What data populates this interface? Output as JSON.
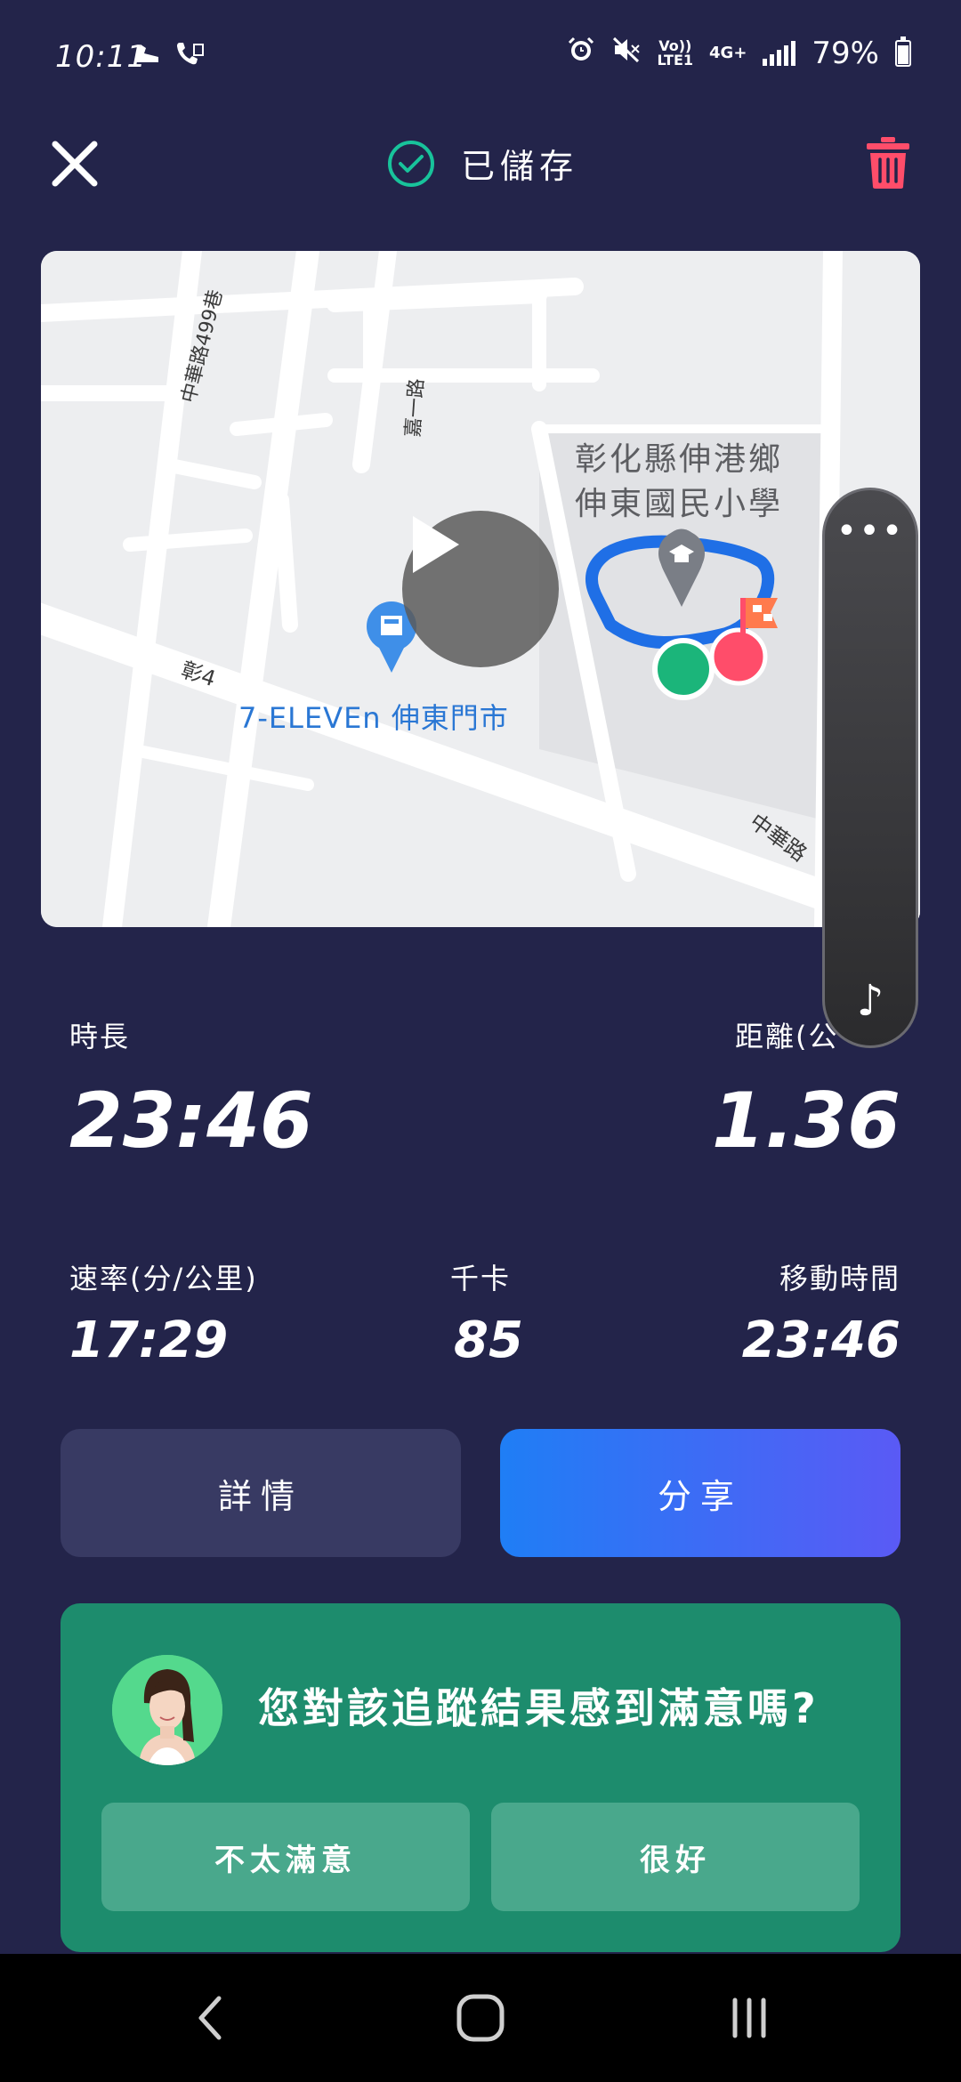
{
  "status_bar": {
    "time": "10:11",
    "network_top": "Vo))",
    "network_bottom": "LTE1",
    "network_type": "4G+",
    "battery": "79%",
    "battery_level": 0.79,
    "icons": [
      "shoe-icon",
      "call-icon",
      "alarm-icon",
      "mute-icon",
      "signal-icon",
      "battery-icon"
    ]
  },
  "top_bar": {
    "saved_label": "已儲存",
    "close_icon": "close-icon",
    "trash_icon": "trash-icon",
    "accent": "#18c39b",
    "trash_color": "#ff4d6a"
  },
  "map": {
    "street_labels": {
      "lane": "中華路499巷",
      "road_a": "嘉一路",
      "zhang4": "彰4",
      "zhonghua": "中華路"
    },
    "school_line1": "彰化縣伸港鄉",
    "school_line2": "伸東國民小學",
    "store_name": "7-ELEVEn 伸東門市",
    "route_color": "#1f6fe6",
    "start_color": "#1bb57a",
    "end_color": "#ff4d6a"
  },
  "side_panel": {
    "more": "•••",
    "music": "♪"
  },
  "stats": {
    "duration_label": "時長",
    "duration_value": "23:46",
    "distance_label": "距離(公",
    "distance_value": "1.36",
    "pace_label": "速率(分/公里)",
    "pace_value": "17:29",
    "calories_label": "千卡",
    "calories_value": "85",
    "moving_label": "移動時間",
    "moving_value": "23:46"
  },
  "buttons": {
    "details": "詳情",
    "share": "分享"
  },
  "feedback": {
    "question": "您對該追蹤結果感到滿意嗎?",
    "not_satisfied": "不太滿意",
    "good": "很好"
  }
}
